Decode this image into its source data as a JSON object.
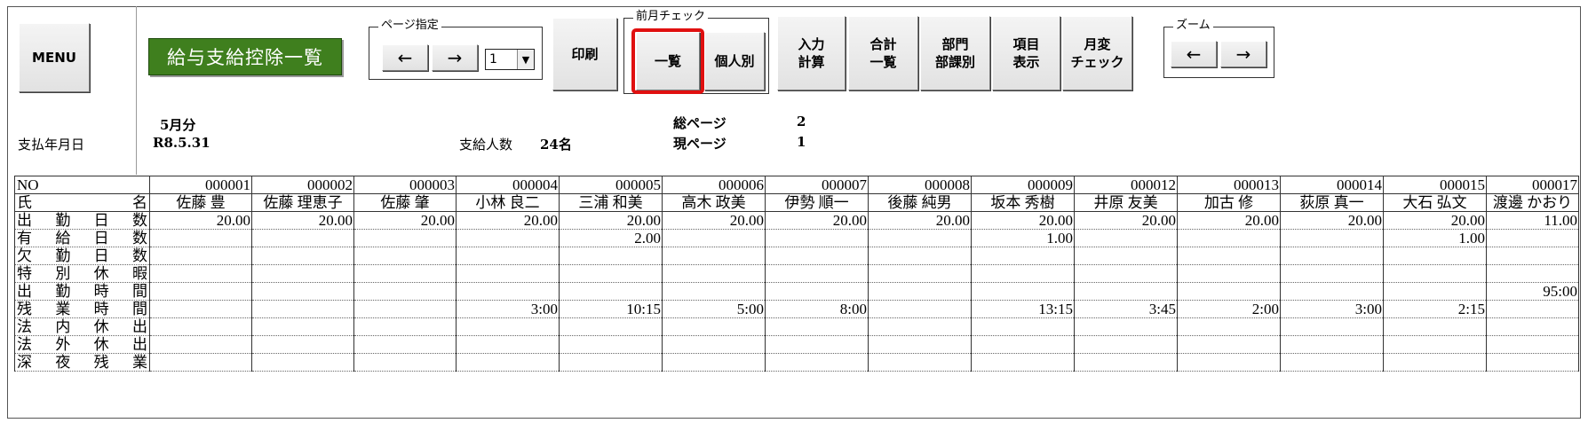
{
  "toolbar": {
    "menu": "MENU",
    "title": "給与支給控除一覧",
    "page_group_label": "ページ指定",
    "prev_arrow": "←",
    "next_arrow": "→",
    "page_select_value": "1",
    "print": "印刷",
    "prev_month_label": "前月チェック",
    "list": "一覧",
    "individual": "個人別",
    "input_calc": [
      "入力",
      "計算"
    ],
    "total_list": [
      "合計",
      "一覧"
    ],
    "dept": [
      "部門",
      "部課別"
    ],
    "item_display": [
      "項目",
      "表示"
    ],
    "monthly_check": [
      "月変",
      "チェック"
    ],
    "zoom_label": "ズーム",
    "zoom_prev": "←",
    "zoom_next": "→"
  },
  "info": {
    "month": "5月分",
    "pay_date_label": "支払年月日",
    "pay_date": "R8.5.31",
    "payees_label": "支給人数",
    "payees": "24名",
    "total_pages_label": "総ページ",
    "total_pages": "2",
    "current_page_label": "現ページ",
    "current_page": "1"
  },
  "table": {
    "no_label": "NO",
    "name_label": [
      "氏",
      "名"
    ],
    "employee_nos": [
      "000001",
      "000002",
      "000003",
      "000004",
      "000005",
      "000006",
      "000007",
      "000008",
      "000009",
      "000012",
      "000013",
      "000014",
      "000015",
      "000017"
    ],
    "employee_names": [
      "佐藤 豊",
      "佐藤 理恵子",
      "佐藤 肇",
      "小林 良二",
      "三浦 和美",
      "高木 政美",
      "伊勢 順一",
      "後藤 純男",
      "坂本 秀樹",
      "井原 友美",
      "加古 修",
      "荻原 真一",
      "大石 弘文",
      "渡邊 かおり"
    ],
    "rows": [
      {
        "label": [
          "出",
          "勤",
          "日",
          "数"
        ],
        "values": [
          "20.00",
          "20.00",
          "20.00",
          "20.00",
          "20.00",
          "20.00",
          "20.00",
          "20.00",
          "20.00",
          "20.00",
          "20.00",
          "20.00",
          "20.00",
          "11.00"
        ]
      },
      {
        "label": [
          "有",
          "給",
          "日",
          "数"
        ],
        "values": [
          "",
          "",
          "",
          "",
          "2.00",
          "",
          "",
          "",
          "1.00",
          "",
          "",
          "",
          "1.00",
          ""
        ]
      },
      {
        "label": [
          "欠",
          "勤",
          "日",
          "数"
        ],
        "values": [
          "",
          "",
          "",
          "",
          "",
          "",
          "",
          "",
          "",
          "",
          "",
          "",
          "",
          ""
        ]
      },
      {
        "label": [
          "特",
          "別",
          "休",
          "暇"
        ],
        "values": [
          "",
          "",
          "",
          "",
          "",
          "",
          "",
          "",
          "",
          "",
          "",
          "",
          "",
          ""
        ]
      },
      {
        "label": [
          "出",
          "勤",
          "時",
          "間"
        ],
        "values": [
          "",
          "",
          "",
          "",
          "",
          "",
          "",
          "",
          "",
          "",
          "",
          "",
          "",
          "95:00"
        ]
      },
      {
        "label": [
          "残",
          "業",
          "時",
          "間"
        ],
        "values": [
          "",
          "",
          "",
          "3:00",
          "10:15",
          "5:00",
          "8:00",
          "",
          "13:15",
          "3:45",
          "2:00",
          "3:00",
          "2:15",
          ""
        ]
      },
      {
        "label": [
          "法",
          "内",
          "休",
          "出"
        ],
        "values": [
          "",
          "",
          "",
          "",
          "",
          "",
          "",
          "",
          "",
          "",
          "",
          "",
          "",
          ""
        ]
      },
      {
        "label": [
          "法",
          "外",
          "休",
          "出"
        ],
        "values": [
          "",
          "",
          "",
          "",
          "",
          "",
          "",
          "",
          "",
          "",
          "",
          "",
          "",
          ""
        ]
      },
      {
        "label": [
          "深",
          "夜",
          "残",
          "業"
        ],
        "values": [
          "",
          "",
          "",
          "",
          "",
          "",
          "",
          "",
          "",
          "",
          "",
          "",
          "",
          ""
        ]
      }
    ]
  }
}
